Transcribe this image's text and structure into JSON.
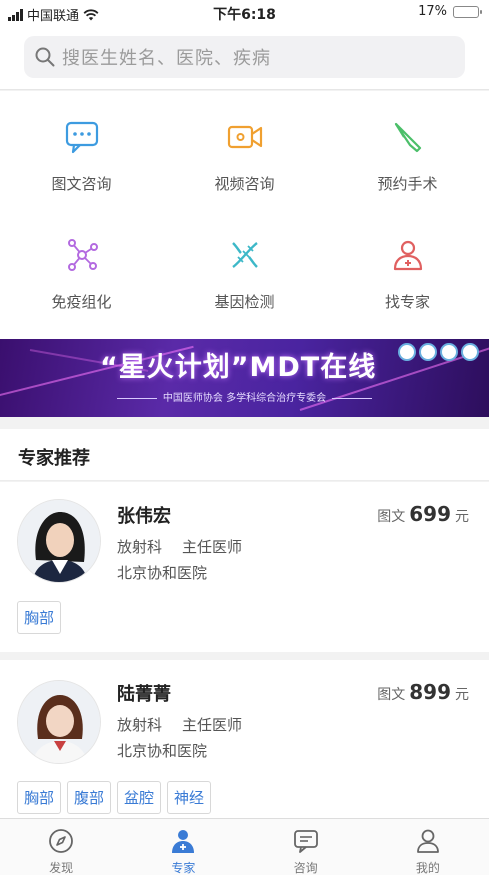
{
  "status_bar": {
    "carrier": "中国联通",
    "time": "下午6:18",
    "battery": "17%",
    "battery_level": 0.17
  },
  "search": {
    "placeholder": "搜医生姓名、医院、疾病"
  },
  "services": [
    {
      "label": "图文咨询",
      "icon": "chat-icon",
      "color": "#3d9be0"
    },
    {
      "label": "视频咨询",
      "icon": "video-camera-icon",
      "color": "#f0a030"
    },
    {
      "label": "预约手术",
      "icon": "scalpel-icon",
      "color": "#4cbf6a"
    },
    {
      "label": "免疫组化",
      "icon": "molecule-icon",
      "color": "#b36ae0"
    },
    {
      "label": "基因检测",
      "icon": "dna-icon",
      "color": "#3db8c8"
    },
    {
      "label": "找专家",
      "icon": "doctor-icon",
      "color": "#e06060"
    }
  ],
  "banner": {
    "title": "“星火计划”MDT在线",
    "subtitle": "中国医师协会 多学科综合治疗专委会"
  },
  "section": {
    "title": "专家推荐"
  },
  "doctors": [
    {
      "name": "张伟宏",
      "department": "放射科",
      "title": "主任医师",
      "hospital": "北京协和医院",
      "price_label": "图文",
      "price": "699",
      "price_unit": "元",
      "tags": [
        "胸部"
      ]
    },
    {
      "name": "陆菁菁",
      "department": "放射科",
      "title": "主任医师",
      "hospital": "北京协和医院",
      "price_label": "图文",
      "price": "899",
      "price_unit": "元",
      "tags": [
        "胸部",
        "腹部",
        "盆腔",
        "神经"
      ]
    }
  ],
  "tabs": [
    {
      "label": "发现",
      "icon": "compass-icon",
      "active": false
    },
    {
      "label": "专家",
      "icon": "doctor-icon",
      "active": true
    },
    {
      "label": "咨询",
      "icon": "chat-icon",
      "active": false
    },
    {
      "label": "我的",
      "icon": "user-icon",
      "active": false
    }
  ],
  "colors": {
    "accent": "#3a7bd5",
    "banner": "#4a24a0"
  }
}
